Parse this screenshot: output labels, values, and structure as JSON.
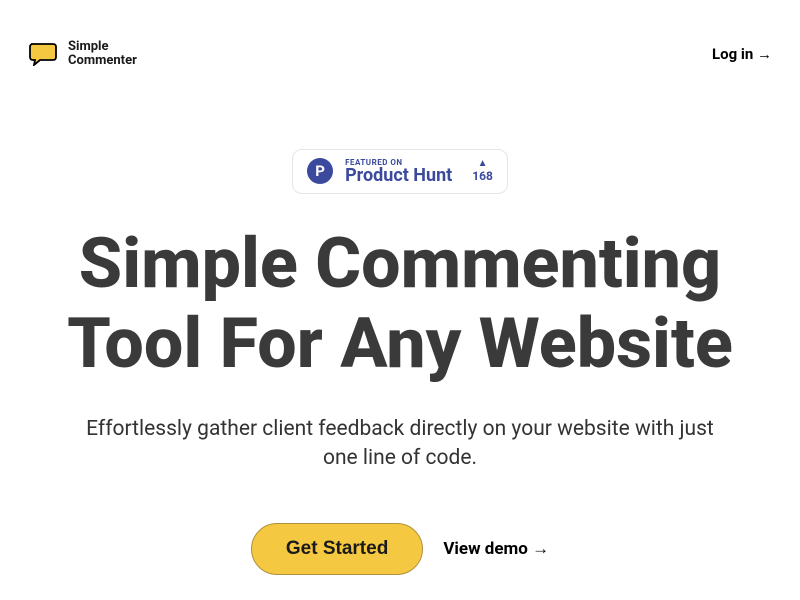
{
  "header": {
    "logo_text_top": "Simple",
    "logo_text_bottom": "Commenter",
    "login_label": "Log in →"
  },
  "badge": {
    "icon_letter": "P",
    "featured_label": "FEATURED ON",
    "name": "Product Hunt",
    "upvote_count": "168"
  },
  "hero": {
    "title": "Simple Commenting Tool For Any Website",
    "subtitle": "Effortlessly gather client feedback directly on your website with just one line of code."
  },
  "cta": {
    "primary": "Get Started",
    "secondary": "View demo →"
  }
}
